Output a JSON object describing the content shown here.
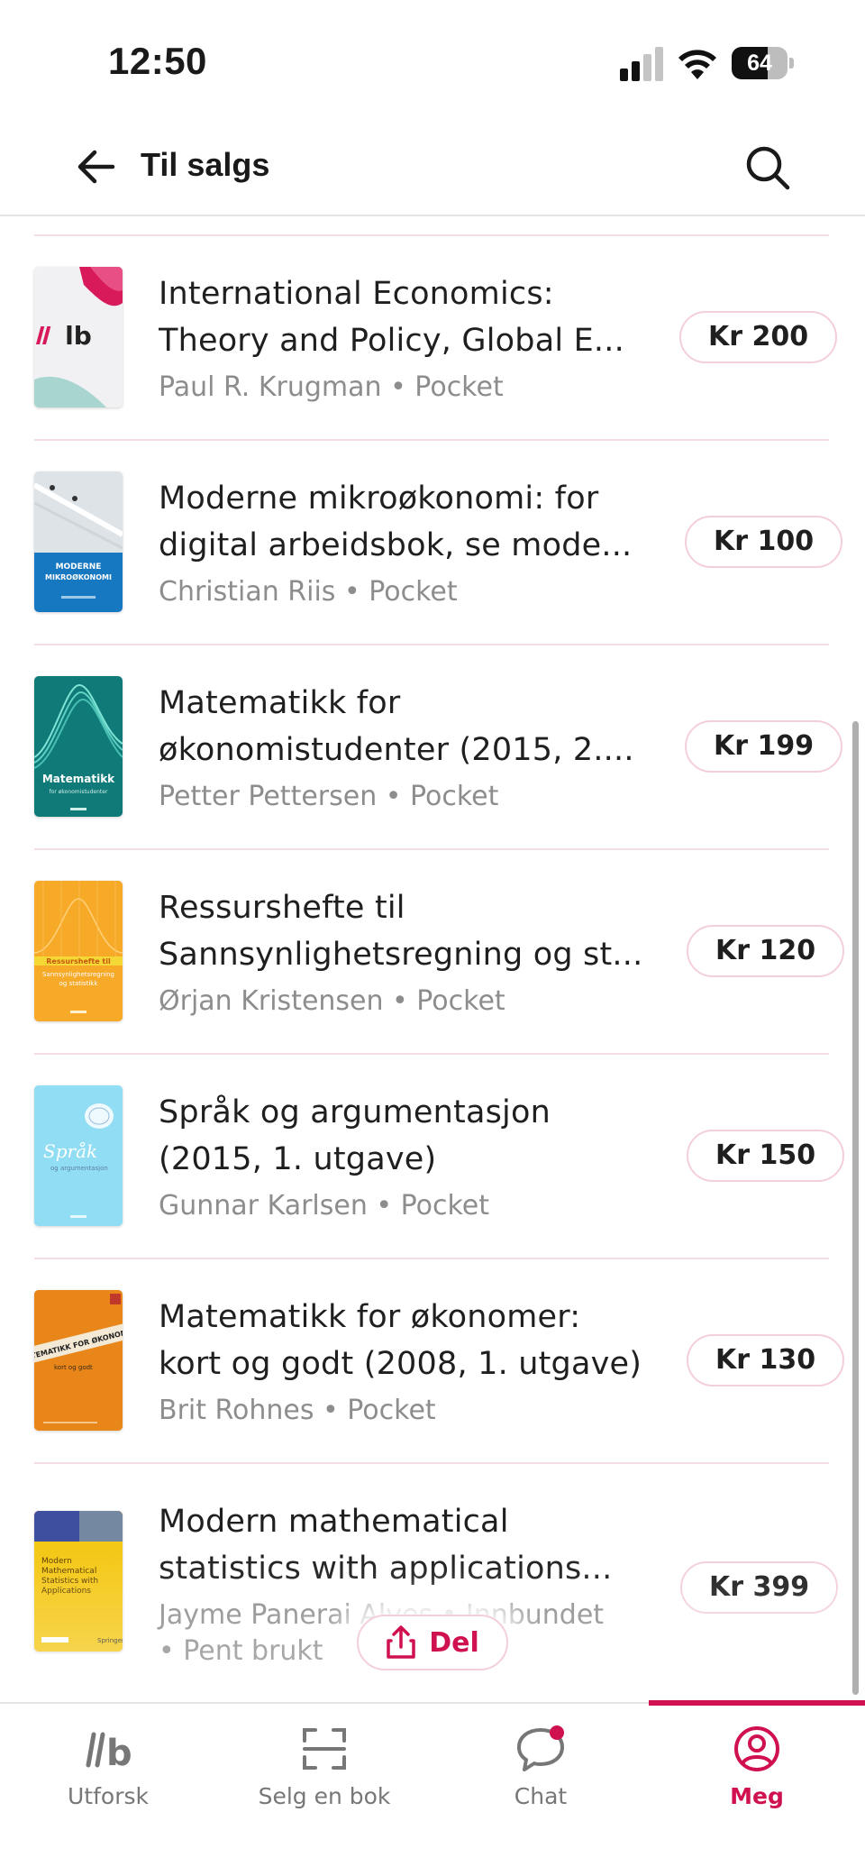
{
  "status_bar": {
    "time": "12:50",
    "battery_level": "64",
    "battery_percent": 64,
    "icons": [
      "cellular-signal-icon",
      "wifi-icon",
      "battery-icon"
    ]
  },
  "header": {
    "title": "Til salgs",
    "back_icon": "arrow-left-icon",
    "search_icon": "search-icon"
  },
  "colors": {
    "accent": "#d0114f",
    "divider": "#f4dde3",
    "muted_text": "#8d8d8d"
  },
  "listings": [
    {
      "title_line1": "International Economics:",
      "title_line2": "Theory and Policy, Global E...",
      "author": "Paul R. Krugman",
      "format": "Pocket",
      "meta": "Paul R. Krugman • Pocket",
      "price": "Kr 200",
      "cover": "placeholder-lb-cover"
    },
    {
      "title_line1": "Moderne mikroøkonomi: for",
      "title_line2": "digital arbeidsbok, se mode...",
      "author": "Christian Riis",
      "format": "Pocket",
      "meta": "Christian Riis • Pocket",
      "price": "Kr 100",
      "cover": "moderne-mikrookonomi-cover",
      "cover_text": "MODERNE MIKROØKONOMI"
    },
    {
      "title_line1": "Matematikk for",
      "title_line2": "økonomistudenter (2015, 2....",
      "author": "Petter Pettersen",
      "format": "Pocket",
      "meta": "Petter Pettersen • Pocket",
      "price": "Kr 199",
      "cover": "matematikk-teal-cover",
      "cover_text": "Matematikk"
    },
    {
      "title_line1": "Ressurshefte til",
      "title_line2": "Sannsynlighetsregning og st...",
      "author": "Ørjan Kristensen",
      "format": "Pocket",
      "meta": "Ørjan Kristensen • Pocket",
      "price": "Kr 120",
      "cover": "ressurshefte-orange-cover",
      "cover_text": "Ressurshefte til"
    },
    {
      "title_line1": "Språk og argumentasjon",
      "title_line2": "(2015, 1. utgave)",
      "author": "Gunnar Karlsen",
      "format": "Pocket",
      "meta": "Gunnar Karlsen • Pocket",
      "price": "Kr 150",
      "cover": "sprak-lightblue-cover",
      "cover_text": "Språk"
    },
    {
      "title_line1": "Matematikk for økonomer:",
      "title_line2": "kort og godt (2008, 1. utgave)",
      "author": "Brit Rohnes",
      "format": "Pocket",
      "meta": "Brit Rohnes • Pocket",
      "price": "Kr 130",
      "cover": "matematikk-okonomer-orange-cover",
      "cover_text": "MATEMATIKK FOR ØKONOMER"
    },
    {
      "title_line1": "Modern mathematical",
      "title_line2": "statistics with applications...",
      "author": "Jayme Panerai Alves",
      "format": "Innbundet",
      "condition": "Pent brukt",
      "meta_line1": "Jayme Panerai Alves • Innbundet",
      "meta_line2": "• Pent brukt",
      "price": "Kr 399",
      "cover": "modern-math-stats-yellow-cover",
      "cover_text": "Modern Mathematical Statistics with Applications"
    }
  ],
  "share_button": {
    "label": "Del",
    "icon": "share-icon"
  },
  "tab_bar": {
    "tabs": [
      {
        "label": "Utforsk",
        "icon": "lb-logo-icon",
        "active": false
      },
      {
        "label": "Selg en bok",
        "icon": "scan-icon",
        "active": false
      },
      {
        "label": "Chat",
        "icon": "chat-bubble-icon",
        "active": false,
        "badge": true
      },
      {
        "label": "Meg",
        "icon": "profile-icon",
        "active": true
      }
    ]
  }
}
